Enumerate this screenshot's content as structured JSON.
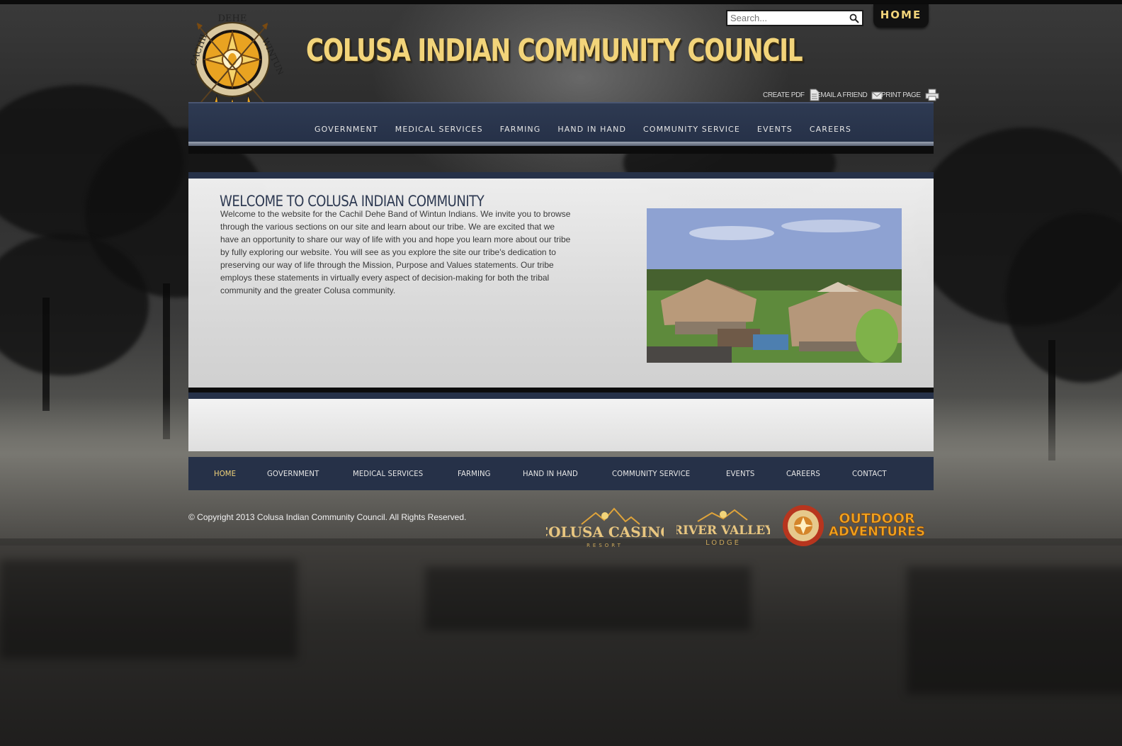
{
  "header": {
    "site_title": "COLUSA INDIAN COMMUNITY COUNCIL",
    "logo_ring_text": [
      "CACHIL",
      "DEHE",
      "WINTUN"
    ],
    "search": {
      "placeholder": "Search...",
      "value": ""
    },
    "home_tab": "HOME",
    "tools": {
      "create_pdf": "CREATE PDF",
      "email_friend": "EMAIL A FRIEND",
      "print_page": "PRINT PAGE"
    }
  },
  "top_nav": [
    "GOVERNMENT",
    "MEDICAL SERVICES",
    "FARMING",
    "HAND IN HAND",
    "COMMUNITY SERVICE",
    "EVENTS",
    "CAREERS"
  ],
  "main": {
    "welcome_title": "WELCOME TO COLUSA INDIAN COMMUNITY",
    "welcome_text": "Welcome to the website for the Cachil Dehe Band of Wintun Indians. We invite you to browse through the various sections on our site and learn about our tribe. We are excited that we have an opportunity to share our way of life with you and hope you learn more about our tribe by fully exploring our website. You will see as you explore the site our tribe's dedication to preserving our way of life through the Mission, Purpose and Values statements. Our tribe employs these statements in virtually every aspect of decision-making for both the tribal community and the greater Colusa community."
  },
  "footer_nav": [
    "HOME",
    "GOVERNMENT",
    "MEDICAL SERVICES",
    "FARMING",
    "HAND IN HAND",
    "COMMUNITY SERVICE",
    "EVENTS",
    "CAREERS",
    "CONTACT"
  ],
  "footer": {
    "copyright": "© Copyright 2013 Colusa Indian Community Council. All Rights Reserved.",
    "sponsors": {
      "casino": {
        "name": "COLUSA CASINO",
        "sub": "RESORT"
      },
      "lodge": {
        "name": "RIVER VALLEY",
        "sub": "LODGE"
      },
      "outdoor": {
        "line1": "OUTDOOR",
        "line2": "ADVENTURES"
      }
    }
  },
  "colors": {
    "navy": "#263148",
    "gold": "#f2d47a",
    "active_nav": "#f2d47a"
  }
}
